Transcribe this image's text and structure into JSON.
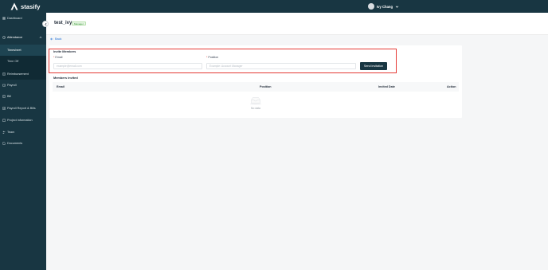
{
  "brand": {
    "name": "stasify"
  },
  "user": {
    "name": "Ivy Chang"
  },
  "sidebar": {
    "items": [
      {
        "label": "Dashboard",
        "icon": "dashboard-icon"
      },
      {
        "label": "Attendance",
        "icon": "clock-icon"
      },
      {
        "label": "Reimbursement",
        "icon": "receipt-icon"
      },
      {
        "label": "Payroll",
        "icon": "wallet-icon"
      },
      {
        "label": "Bill",
        "icon": "bill-icon"
      },
      {
        "label": "Payroll Report & Bills",
        "icon": "report-icon"
      },
      {
        "label": "Project information",
        "icon": "project-icon"
      },
      {
        "label": "Team",
        "icon": "team-icon"
      },
      {
        "label": "Documents",
        "icon": "documents-icon"
      }
    ],
    "submenu": [
      {
        "label": "Timesheet",
        "active": true
      },
      {
        "label": "Time Off",
        "active": false
      }
    ]
  },
  "header": {
    "title": "test_ivy",
    "role_badge": "Manager"
  },
  "back_label": "Back",
  "invite": {
    "title": "Invite Members",
    "email_label": "Email",
    "email_placeholder": "example@email.com",
    "position_label": "Position",
    "position_placeholder": "Example: Account Manager",
    "send_label": "Send invitation"
  },
  "members": {
    "title": "Members invited",
    "columns": [
      "Email",
      "Position",
      "Invited Date",
      "Action"
    ],
    "rows": [],
    "empty_text": "No data"
  },
  "colors": {
    "sidebar_bg": "#183642",
    "primary": "#183642",
    "link": "#1f6fd6",
    "highlight": "#e53935",
    "badge_text": "#3c9a3f"
  }
}
